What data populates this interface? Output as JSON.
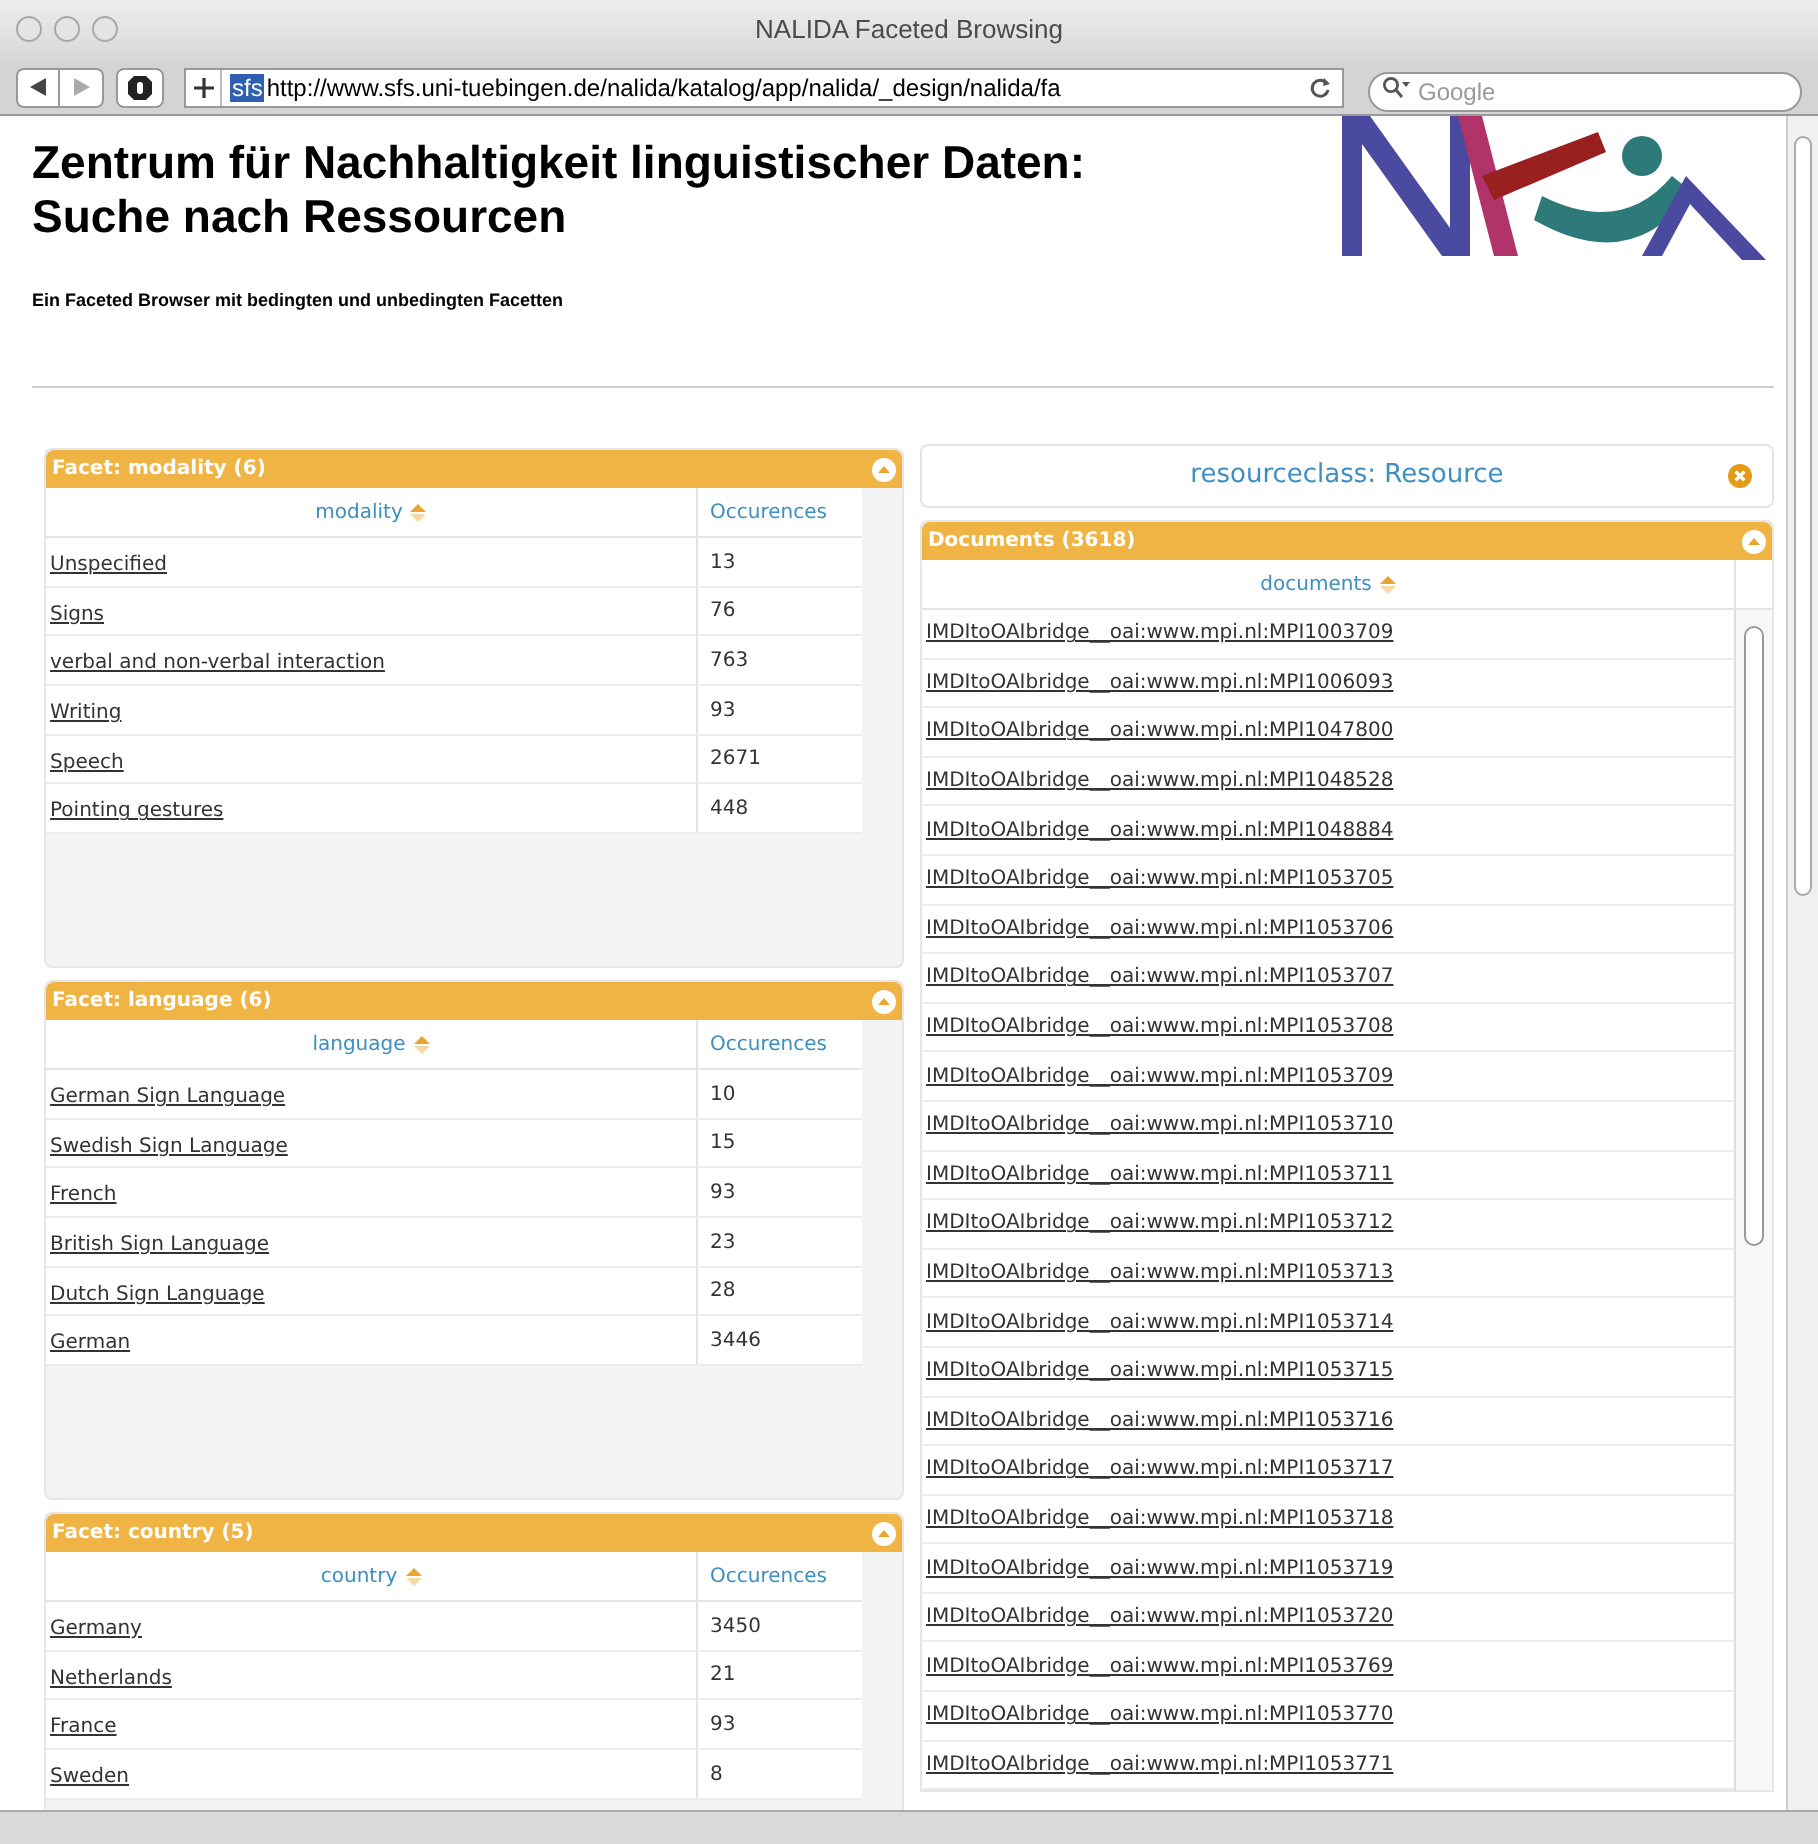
{
  "window": {
    "title": "NALIDA Faceted Browsing"
  },
  "toolbar": {
    "site_badge": "sfs",
    "url": "http://www.sfs.uni-tuebingen.de/nalida/katalog/app/nalida/_design/nalida/fa",
    "search_placeholder": "Google"
  },
  "header": {
    "heading_lines": [
      "Zentrum für Nachhaltigkeit linguistischer Daten:",
      "Suche nach Ressourcen"
    ],
    "subtitle": "Ein Faceted Browser mit bedingten und unbedingten Facetten"
  },
  "facets": [
    {
      "title": "Facet: modality (6)",
      "column": "modality",
      "count_column": "Occurences",
      "rows": [
        {
          "label": "Unspecified",
          "count": "13"
        },
        {
          "label": "Signs",
          "count": "76"
        },
        {
          "label": "verbal and non-verbal interaction",
          "count": "763"
        },
        {
          "label": "Writing",
          "count": "93"
        },
        {
          "label": "Speech",
          "count": "2671"
        },
        {
          "label": "Pointing gestures",
          "count": "448"
        }
      ]
    },
    {
      "title": "Facet: language (6)",
      "column": "language",
      "count_column": "Occurences",
      "rows": [
        {
          "label": "German Sign Language",
          "count": "10"
        },
        {
          "label": "Swedish Sign Language",
          "count": "15"
        },
        {
          "label": "French",
          "count": "93"
        },
        {
          "label": "British Sign Language",
          "count": "23"
        },
        {
          "label": "Dutch Sign Language",
          "count": "28"
        },
        {
          "label": "German",
          "count": "3446"
        }
      ]
    },
    {
      "title": "Facet: country (5)",
      "column": "country",
      "count_column": "Occurences",
      "rows": [
        {
          "label": "Germany",
          "count": "3450"
        },
        {
          "label": "Netherlands",
          "count": "21"
        },
        {
          "label": "France",
          "count": "93"
        },
        {
          "label": "Sweden",
          "count": "8"
        }
      ]
    }
  ],
  "filter": {
    "label": "resourceclass: Resource"
  },
  "documents": {
    "title": "Documents (3618)",
    "column": "documents",
    "rows": [
      "IMDItoOAIbridge__oai:www.mpi.nl:MPI1003709",
      "IMDItoOAIbridge__oai:www.mpi.nl:MPI1006093",
      "IMDItoOAIbridge__oai:www.mpi.nl:MPI1047800",
      "IMDItoOAIbridge__oai:www.mpi.nl:MPI1048528",
      "IMDItoOAIbridge__oai:www.mpi.nl:MPI1048884",
      "IMDItoOAIbridge__oai:www.mpi.nl:MPI1053705",
      "IMDItoOAIbridge__oai:www.mpi.nl:MPI1053706",
      "IMDItoOAIbridge__oai:www.mpi.nl:MPI1053707",
      "IMDItoOAIbridge__oai:www.mpi.nl:MPI1053708",
      "IMDItoOAIbridge__oai:www.mpi.nl:MPI1053709",
      "IMDItoOAIbridge__oai:www.mpi.nl:MPI1053710",
      "IMDItoOAIbridge__oai:www.mpi.nl:MPI1053711",
      "IMDItoOAIbridge__oai:www.mpi.nl:MPI1053712",
      "IMDItoOAIbridge__oai:www.mpi.nl:MPI1053713",
      "IMDItoOAIbridge__oai:www.mpi.nl:MPI1053714",
      "IMDItoOAIbridge__oai:www.mpi.nl:MPI1053715",
      "IMDItoOAIbridge__oai:www.mpi.nl:MPI1053716",
      "IMDItoOAIbridge__oai:www.mpi.nl:MPI1053717",
      "IMDItoOAIbridge__oai:www.mpi.nl:MPI1053718",
      "IMDItoOAIbridge__oai:www.mpi.nl:MPI1053719",
      "IMDItoOAIbridge__oai:www.mpi.nl:MPI1053720",
      "IMDItoOAIbridge__oai:www.mpi.nl:MPI1053769",
      "IMDItoOAIbridge__oai:www.mpi.nl:MPI1053770",
      "IMDItoOAIbridge__oai:www.mpi.nl:MPI1053771"
    ]
  }
}
